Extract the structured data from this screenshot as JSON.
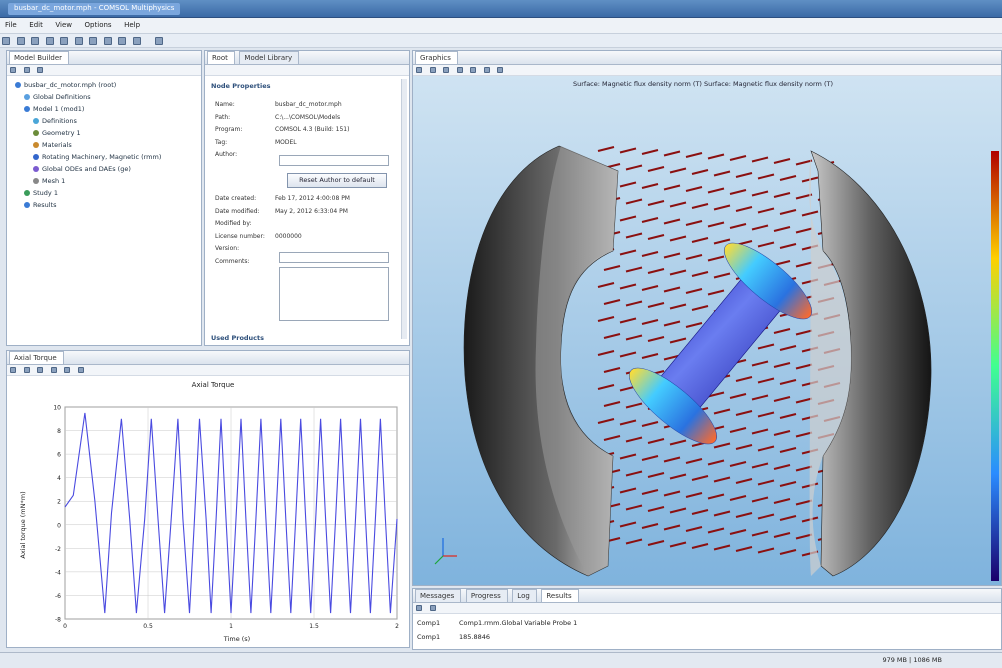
{
  "window": {
    "title": "busbar_dc_motor.mph - COMSOL Multiphysics"
  },
  "menu": [
    "File",
    "Edit",
    "View",
    "Options",
    "Help"
  ],
  "model_builder": {
    "tab_label": "Model Builder",
    "items": [
      {
        "label": "busbar_dc_motor.mph (root)",
        "indent": 0,
        "color": "#3a7bd5"
      },
      {
        "label": "Global Definitions",
        "indent": 1,
        "color": "#5aa0e0"
      },
      {
        "label": "Model 1 (mod1)",
        "indent": 1,
        "color": "#3a7bd5"
      },
      {
        "label": "Definitions",
        "indent": 2,
        "color": "#4aa6d8"
      },
      {
        "label": "Geometry 1",
        "indent": 2,
        "color": "#6b8c3a"
      },
      {
        "label": "Materials",
        "indent": 2,
        "color": "#c98a2e"
      },
      {
        "label": "Rotating Machinery, Magnetic (rmm)",
        "indent": 2,
        "color": "#3366cc"
      },
      {
        "label": "Global ODEs and DAEs (ge)",
        "indent": 2,
        "color": "#7b5bd0"
      },
      {
        "label": "Mesh 1",
        "indent": 2,
        "color": "#888888"
      },
      {
        "label": "Study 1",
        "indent": 1,
        "color": "#3a9c5a"
      },
      {
        "label": "Results",
        "indent": 1,
        "color": "#3a7bd5"
      }
    ]
  },
  "root_panel": {
    "tabs": [
      "Root",
      "Model Library"
    ],
    "section_title": "Node Properties",
    "rows": [
      {
        "k": "Name:",
        "v": "busbar_dc_motor.mph"
      },
      {
        "k": "Path:",
        "v": "C:\\...\\COMSOL\\Models"
      },
      {
        "k": "Program:",
        "v": "COMSOL 4.3 (Build: 151)"
      },
      {
        "k": "Tag:",
        "v": "MODEL"
      },
      {
        "k": "Author:",
        "v": ""
      }
    ],
    "reset_button": "Reset Author to default",
    "rows2": [
      {
        "k": "Date created:",
        "v": "Feb 17, 2012 4:00:08 PM"
      },
      {
        "k": "Date modified:",
        "v": "May 2, 2012 6:33:04 PM"
      },
      {
        "k": "Modified by:",
        "v": ""
      },
      {
        "k": "License number:",
        "v": "0000000"
      },
      {
        "k": "Version:",
        "v": ""
      },
      {
        "k": "Comments:",
        "v": ""
      }
    ],
    "used_products": "Used Products"
  },
  "graphics": {
    "tab_label": "Graphics",
    "title_text": "Surface: Magnetic flux density norm (T)  Surface: Magnetic flux density norm (T)"
  },
  "axial_torque": {
    "tab_label": "Axial Torque",
    "plot_title": "Axial Torque",
    "ylabel": "Axial torque (mN*m)",
    "xlabel": "Time (s)"
  },
  "messages": {
    "tabs": [
      "Messages",
      "Progress",
      "Log",
      "Results"
    ],
    "header_col": "Comp1",
    "row_label": "Comp1",
    "header_text": "Comp1.rmm.Global Variable Probe 1",
    "value": "185.8846"
  },
  "status": {
    "memory": "979 MB | 1086 MB"
  },
  "chart_data": {
    "type": "line",
    "title": "Axial Torque",
    "xlabel": "Time (s)",
    "ylabel": "Axial torque (mN*m)",
    "xlim": [
      0,
      2
    ],
    "ylim": [
      -8,
      10
    ],
    "x_ticks": [
      "0",
      "0.5",
      "1",
      "1.5",
      "2"
    ],
    "y_ticks": [
      "10",
      "8",
      "6",
      "4",
      "2",
      "0",
      "-2",
      "-4",
      "-6",
      "-8"
    ],
    "series": [
      {
        "color": "#4a4ae0",
        "x": [
          0.0,
          0.05,
          0.12,
          0.18,
          0.24,
          0.28,
          0.34,
          0.39,
          0.43,
          0.48,
          0.52,
          0.56,
          0.6,
          0.64,
          0.68,
          0.71,
          0.75,
          0.78,
          0.81,
          0.85,
          0.88,
          0.91,
          0.94,
          0.97,
          1.0,
          1.03,
          1.06,
          1.09,
          1.12,
          1.15,
          1.18,
          1.21,
          1.24,
          1.27,
          1.3,
          1.33,
          1.36,
          1.39,
          1.42,
          1.45,
          1.48,
          1.51,
          1.54,
          1.57,
          1.6,
          1.63,
          1.66,
          1.69,
          1.72,
          1.75,
          1.78,
          1.81,
          1.84,
          1.87,
          1.9,
          1.93,
          1.96,
          2.0
        ],
        "y": [
          1.5,
          2.5,
          9.5,
          2.0,
          -7.5,
          1.0,
          9.0,
          0.5,
          -7.5,
          0.5,
          9.0,
          0.5,
          -7.5,
          0.5,
          9.0,
          0.5,
          -7.5,
          0.5,
          9.0,
          0.5,
          -7.5,
          0.5,
          9.0,
          0.5,
          -7.5,
          0.5,
          9.0,
          0.5,
          -7.5,
          0.5,
          9.0,
          0.5,
          -7.5,
          0.5,
          9.0,
          0.5,
          -7.5,
          0.5,
          9.0,
          0.5,
          -7.5,
          0.5,
          9.0,
          0.5,
          -7.5,
          0.5,
          9.0,
          0.5,
          -7.5,
          0.5,
          9.0,
          0.5,
          -7.5,
          0.5,
          9.0,
          0.5,
          -7.5,
          0.5
        ]
      }
    ]
  }
}
